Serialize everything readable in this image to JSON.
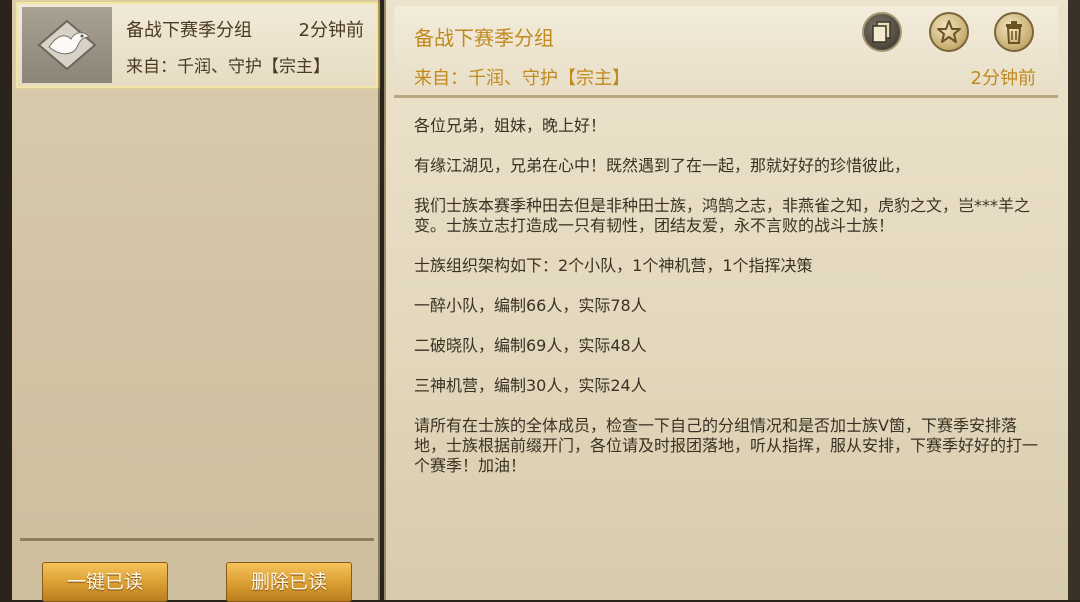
{
  "mail_list": {
    "items": [
      {
        "title": "备战下赛季分组",
        "time": "2分钟前",
        "from": "来自：千润、守护【宗主】",
        "icon": "dove-icon"
      }
    ],
    "buttons": {
      "read_all": "一键已读",
      "delete_read": "删除已读"
    }
  },
  "mail_detail": {
    "title": "备战下赛季分组",
    "from": "来自：千润、守护【宗主】",
    "time": "2分钟前",
    "actions": {
      "copy_icon": "copy-icon",
      "star_icon": "star-icon",
      "trash_icon": "trash-icon"
    },
    "paragraphs": [
      "各位兄弟，姐妹，晚上好！",
      "有缘江湖见，兄弟在心中！既然遇到了在一起，那就好好的珍惜彼此，",
      "我们士族本赛季种田去但是非种田士族，鸿鹄之志，非燕雀之知，虎豹之文，岂***羊之变。士族立志打造成一只有韧性，团结友爱，永不言败的战斗士族！",
      "士族组织架构如下：2个小队，1个神机营，1个指挥决策",
      "一醉小队，编制66人，实际78人",
      "二破晓队，编制69人，实际48人",
      "三神机营，编制30人，实际24人",
      "请所有在士族的全体成员，检查一下自己的分组情况和是否加士族V箇，下赛季安排落地，士族根据前缀开门，各位请及时报团落地，听从指挥，服从安排，下赛季好好的打一个赛季！加油！"
    ]
  },
  "colors": {
    "accent_gold": "#c08a1e",
    "text_brown": "#3b3124",
    "button_gold": "#d69a2f"
  }
}
